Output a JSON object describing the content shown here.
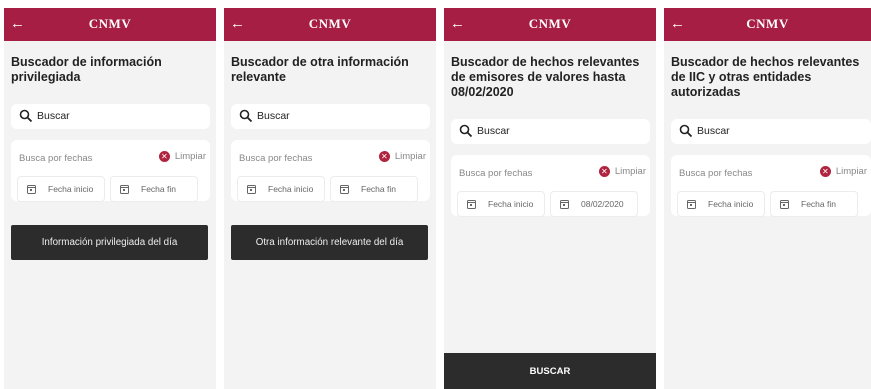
{
  "app": {
    "title": "CNMV",
    "back_icon": "arrow-left-icon",
    "accent": "#a61e43"
  },
  "screens": [
    {
      "heading": "Buscador de información privilegiada",
      "search_placeholder": "Buscar",
      "dates_label": "Busca por fechas",
      "clear_label": "Limpiar",
      "start_date": "Fecha inicio",
      "end_date": "Fecha fin",
      "action_button": "Información privilegiada del día"
    },
    {
      "heading": "Buscador de otra información relevante",
      "search_placeholder": "Buscar",
      "dates_label": "Busca por fechas",
      "clear_label": "Limpiar",
      "start_date": "Fecha inicio",
      "end_date": "Fecha fin",
      "action_button": "Otra información relevante del día"
    },
    {
      "heading": "Buscador de hechos relevantes de emisores de valores hasta 08/02/2020",
      "search_placeholder": "Buscar",
      "dates_label": "Busca por fechas",
      "clear_label": "Limpiar",
      "start_date": "Fecha inicio",
      "end_date": "08/02/2020",
      "submit_button": "BUSCAR"
    },
    {
      "heading": "Buscador de hechos relevantes de IIC y otras entidades autorizadas",
      "search_placeholder": "Buscar",
      "dates_label": "Busca por fechas",
      "clear_label": "Limpiar",
      "start_date": "Fecha inicio",
      "end_date": "Fecha fin"
    }
  ]
}
